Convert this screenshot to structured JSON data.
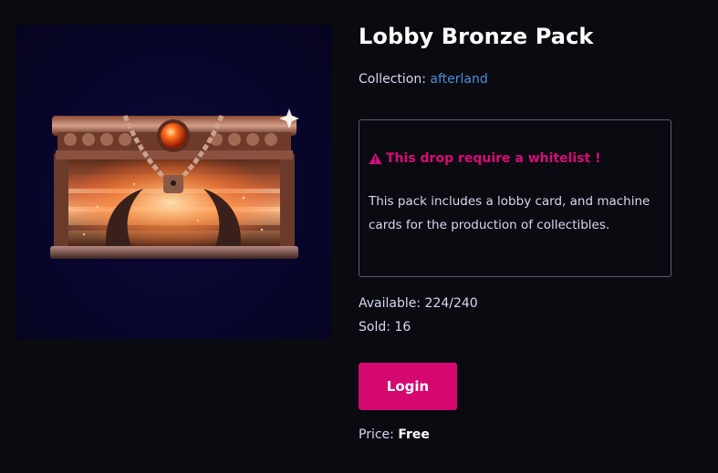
{
  "product": {
    "title": "Lobby Bronze Pack",
    "image_alt_icon": "treasure-chest-image"
  },
  "collection": {
    "label": "Collection:",
    "name": "afterland"
  },
  "notice": {
    "icon": "warning-triangle-icon",
    "text": "This drop require a whitelist !",
    "color": "#d90c78"
  },
  "description": "This pack includes a lobby card, and machine cards for the production of collectibles.",
  "stats": {
    "available_label": "Available:",
    "available_value": "224/240",
    "sold_label": "Sold:",
    "sold_value": "16"
  },
  "actions": {
    "login_label": "Login",
    "login_color": "#d4086f"
  },
  "price": {
    "label": "Price:",
    "value": "Free"
  },
  "colors": {
    "background": "#0a0a11",
    "link": "#4b8fd6",
    "border": "#5a5d72"
  }
}
